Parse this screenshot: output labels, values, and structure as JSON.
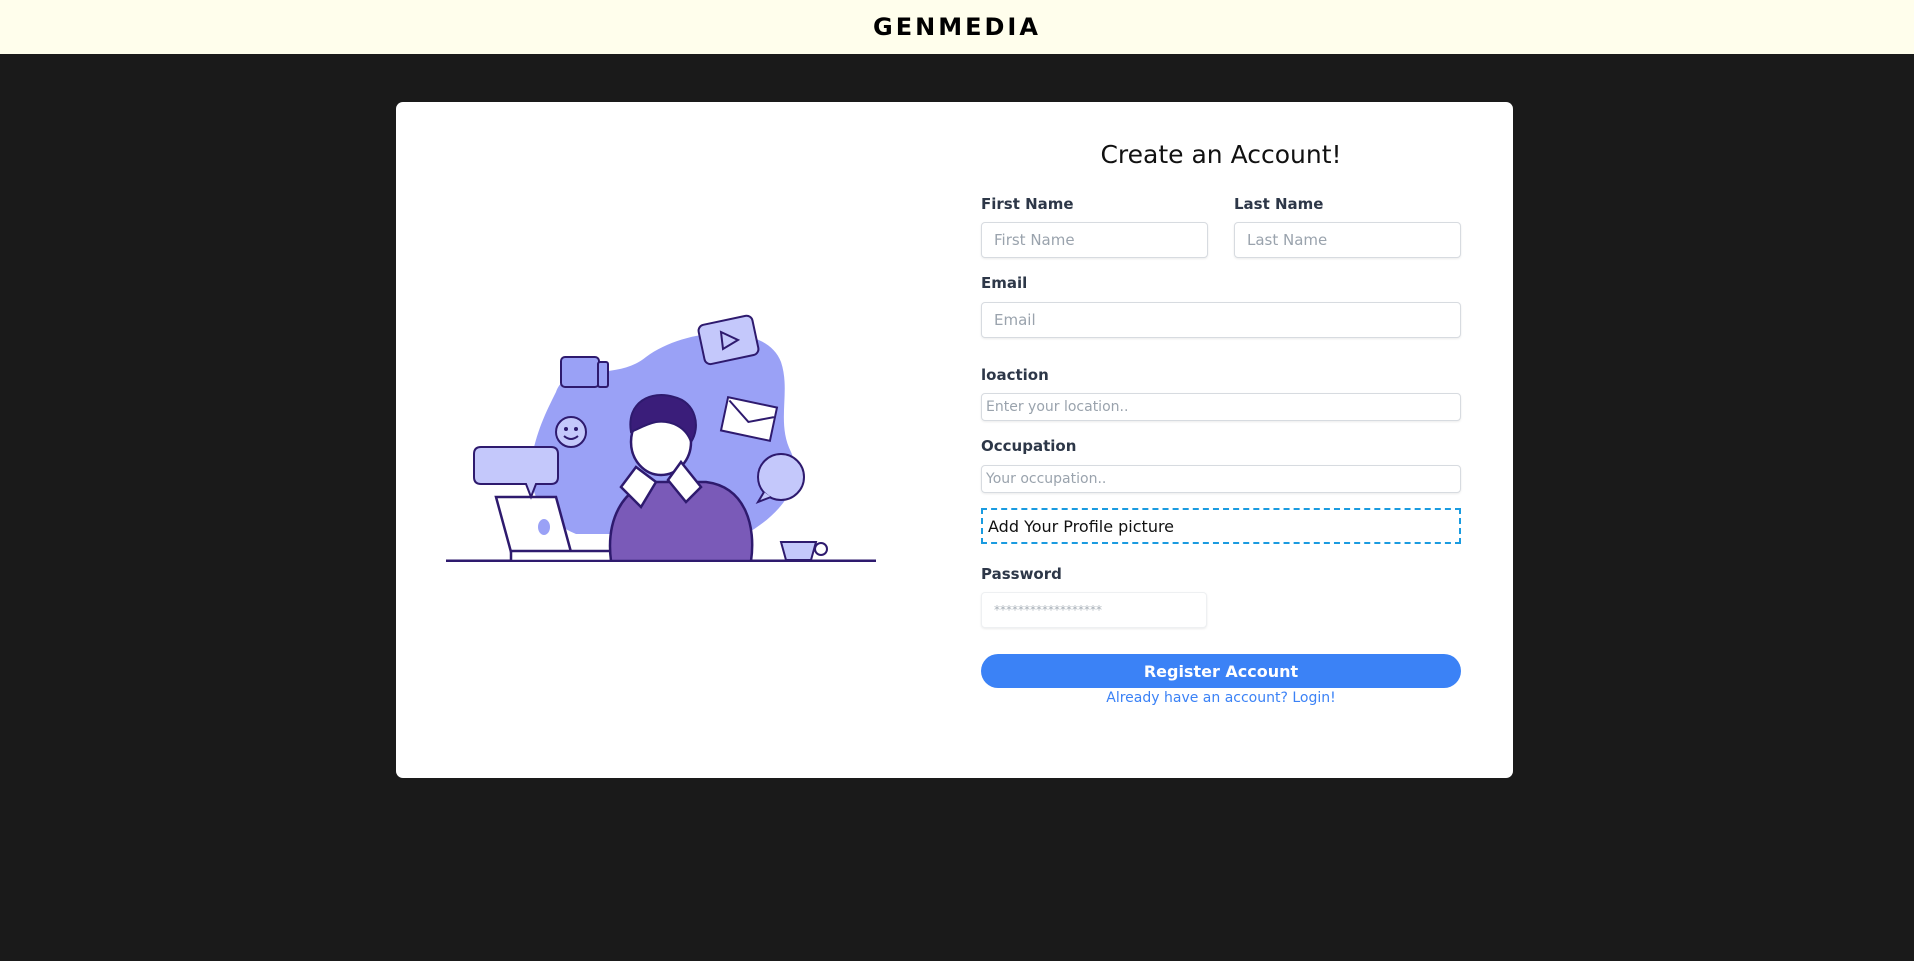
{
  "header": {
    "brand": "GENMEDIA"
  },
  "form": {
    "title": "Create an Account!",
    "first_name": {
      "label": "First Name",
      "placeholder": "First Name",
      "value": ""
    },
    "last_name": {
      "label": "Last Name",
      "placeholder": "Last Name",
      "value": ""
    },
    "email": {
      "label": "Email",
      "placeholder": "Email",
      "value": ""
    },
    "location": {
      "label": "loaction",
      "placeholder": "Enter your location..",
      "value": ""
    },
    "occupation": {
      "label": "Occupation",
      "placeholder": "Your occupation..",
      "value": ""
    },
    "profile_picture": {
      "label": "Add Your Profile picture"
    },
    "password": {
      "label": "Password",
      "placeholder": "******************",
      "value": ""
    },
    "register_button": "Register Account",
    "login_link": "Already have an account? Login!"
  },
  "colors": {
    "header_bg": "#fffeec",
    "page_bg": "#1a1a1a",
    "accent": "#3b82f6",
    "dashed_border": "#1a9be0",
    "illustration_primary": "#9aa1f6",
    "illustration_dark": "#2e1a6e"
  },
  "icons": [
    "thumbs-up-icon",
    "play-icon",
    "mail-icon",
    "smiley-icon",
    "chat-bubble-icon",
    "speech-bubble-icon",
    "laptop-icon",
    "coffee-cup-icon"
  ]
}
